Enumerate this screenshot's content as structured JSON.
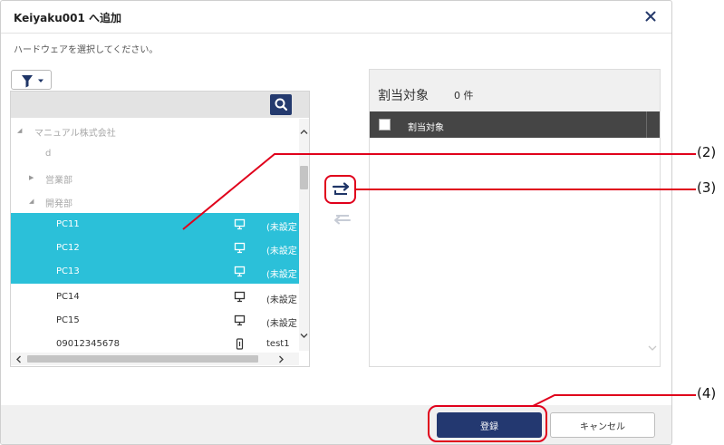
{
  "dialog": {
    "title": "Keiyaku001 へ追加",
    "instruction": "ハードウェアを選択してください。"
  },
  "tree": {
    "rows": [
      {
        "label": "マニュアル株式会社",
        "type": "group",
        "state": "expanded"
      },
      {
        "label": "d",
        "type": "group",
        "state": "leaf"
      },
      {
        "label": "営業部",
        "type": "group",
        "state": "collapsed"
      },
      {
        "label": "開発部",
        "type": "group",
        "state": "expanded"
      },
      {
        "label": "PC11",
        "type": "device",
        "icon": "monitor-icon",
        "status": "(未設定",
        "selected": true
      },
      {
        "label": "PC12",
        "type": "device",
        "icon": "monitor-icon",
        "status": "(未設定",
        "selected": true
      },
      {
        "label": "PC13",
        "type": "device",
        "icon": "monitor-icon",
        "status": "(未設定",
        "selected": true
      },
      {
        "label": "PC14",
        "type": "device",
        "icon": "monitor-icon",
        "status": "(未設定",
        "selected": false
      },
      {
        "label": "PC15",
        "type": "device",
        "icon": "monitor-icon",
        "status": "(未設定",
        "selected": false
      },
      {
        "label": "09012345678",
        "type": "device",
        "icon": "mobile-icon",
        "status": "test1",
        "selected": false
      }
    ]
  },
  "assigned": {
    "title": "割当対象",
    "count": "0 件",
    "column_label": "割当対象"
  },
  "footer": {
    "register_label": "登録",
    "cancel_label": "キャンセル"
  },
  "callouts": [
    "(2)",
    "(3)",
    "(4)"
  ],
  "colors": {
    "selection": "#2bc0d9",
    "primary": "#233870",
    "highlight": "#e0001b"
  }
}
